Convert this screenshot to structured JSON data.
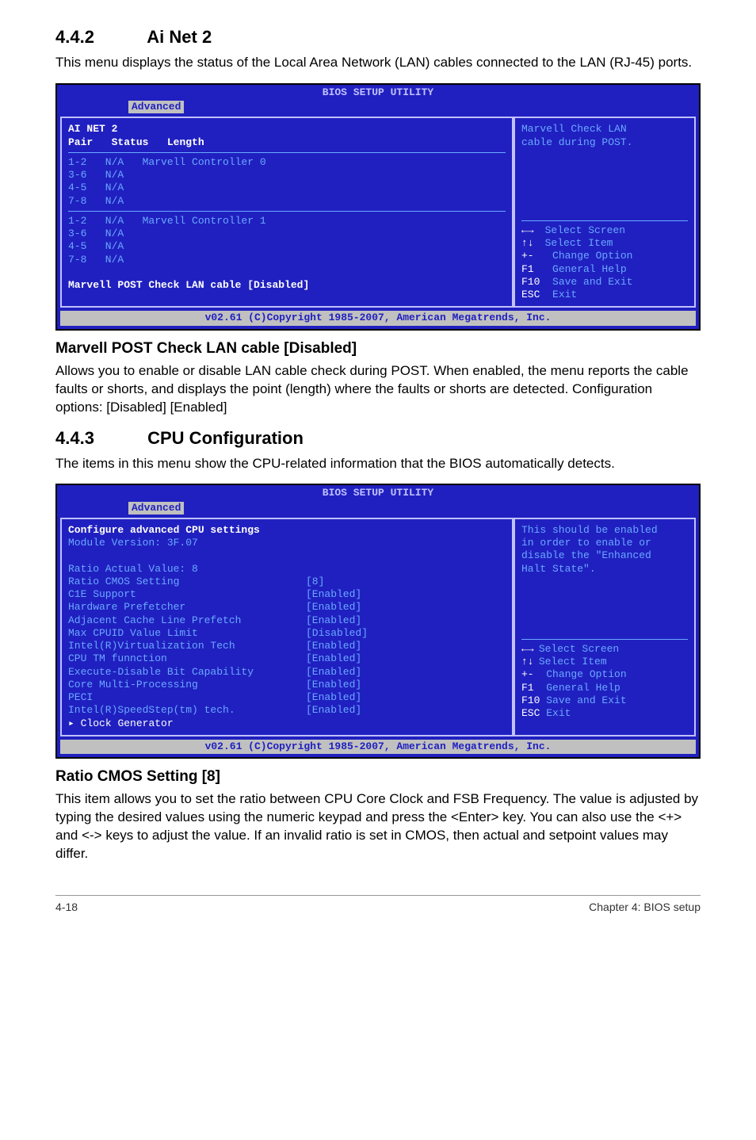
{
  "sec442": {
    "num": "4.4.2",
    "title": "Ai Net 2",
    "intro": "This menu displays the status of the Local Area Network (LAN) cables connected to the LAN (RJ-45) ports."
  },
  "bios1": {
    "setup_title": "BIOS SETUP UTILITY",
    "tab": "Advanced",
    "left": {
      "hdr1": "AI NET 2",
      "hdr2_pair": "Pair",
      "hdr2_status": "Status",
      "hdr2_length": "Length",
      "grp1_lines": "1-2   N/A   Marvell Controller 0\n3-6   N/A\n4-5   N/A\n7-8   N/A",
      "grp2_lines": "1-2   N/A   Marvell Controller 1\n3-6   N/A\n4-5   N/A\n7-8   N/A",
      "marvell_line": "Marvell POST Check LAN cable [Disabled]"
    },
    "right": {
      "help1": "Marvell Check LAN",
      "help2": "cable during POST.",
      "k_lr": "←→",
      "k_ud": "↑↓",
      "k_pm": "+-",
      "k_f1": "F1",
      "k_f10": "F10",
      "k_esc": "ESC",
      "l_select_screen": "Select Screen",
      "l_select_item": "Select Item",
      "l_change": "Change Option",
      "l_help": "General Help",
      "l_save": "Save and Exit",
      "l_exit": "Exit"
    },
    "footer": "v02.61 (C)Copyright 1985-2007, American Megatrends, Inc."
  },
  "marvell": {
    "title": "Marvell POST Check LAN cable [Disabled]",
    "body": "Allows you to enable or disable LAN cable check during POST. When enabled, the menu reports the cable faults or shorts, and displays the point (length) where the faults or shorts are detected. Configuration options: [Disabled] [Enabled]"
  },
  "sec443": {
    "num": "4.4.3",
    "title": "CPU Configuration",
    "intro": "The items in this menu show the CPU-related information that the BIOS automatically detects."
  },
  "bios2": {
    "setup_title": "BIOS SETUP UTILITY",
    "tab": "Advanced",
    "left": {
      "hdr": "Configure advanced CPU settings",
      "mod": "Module Version: 3F.07",
      "rav": "Ratio Actual Value: 8",
      "items": [
        {
          "label": "Ratio CMOS Setting",
          "val": "[8]"
        },
        {
          "label": "C1E Support",
          "val": "[Enabled]"
        },
        {
          "label": "Hardware Prefetcher",
          "val": "[Enabled]"
        },
        {
          "label": "Adjacent Cache Line Prefetch",
          "val": "[Enabled]"
        },
        {
          "label": "Max CPUID Value Limit",
          "val": "[Disabled]"
        },
        {
          "label": "Intel(R)Virtualization Tech",
          "val": "[Enabled]"
        },
        {
          "label": "CPU TM funnction",
          "val": "[Enabled]"
        },
        {
          "label": "Execute-Disable Bit Capability",
          "val": "[Enabled]"
        },
        {
          "label": "Core Multi-Processing",
          "val": "[Enabled]"
        },
        {
          "label": "PECI",
          "val": "[Enabled]"
        },
        {
          "label": "Intel(R)SpeedStep(tm) tech.",
          "val": "[Enabled]"
        }
      ],
      "clock": "Clock Generator"
    },
    "right": {
      "help1": "This should be enabled",
      "help2": "in order to enable or",
      "help3": "disable the \"Enhanced",
      "help4": "Halt State\".",
      "k_lr": "←→",
      "k_ud": "↑↓",
      "k_pm": "+-",
      "k_f1": "F1",
      "k_f10": "F10",
      "k_esc": "ESC",
      "l_select_screen": "Select Screen",
      "l_select_item": "Select Item",
      "l_change": "Change Option",
      "l_help": "General Help",
      "l_save": "Save and Exit",
      "l_exit": "Exit"
    },
    "footer": "v02.61 (C)Copyright 1985-2007, American Megatrends, Inc."
  },
  "ratio": {
    "title": "Ratio CMOS Setting [8]",
    "body": "This item allows you to set the ratio between CPU Core Clock and FSB Frequency. The value is adjusted by typing the desired values using the numeric keypad and press the <Enter> key. You can also use the <+> and <-> keys to adjust the value. If an invalid ratio is set in CMOS, then actual and setpoint values may differ."
  },
  "footer": {
    "left": "4-18",
    "right": "Chapter 4: BIOS setup"
  }
}
